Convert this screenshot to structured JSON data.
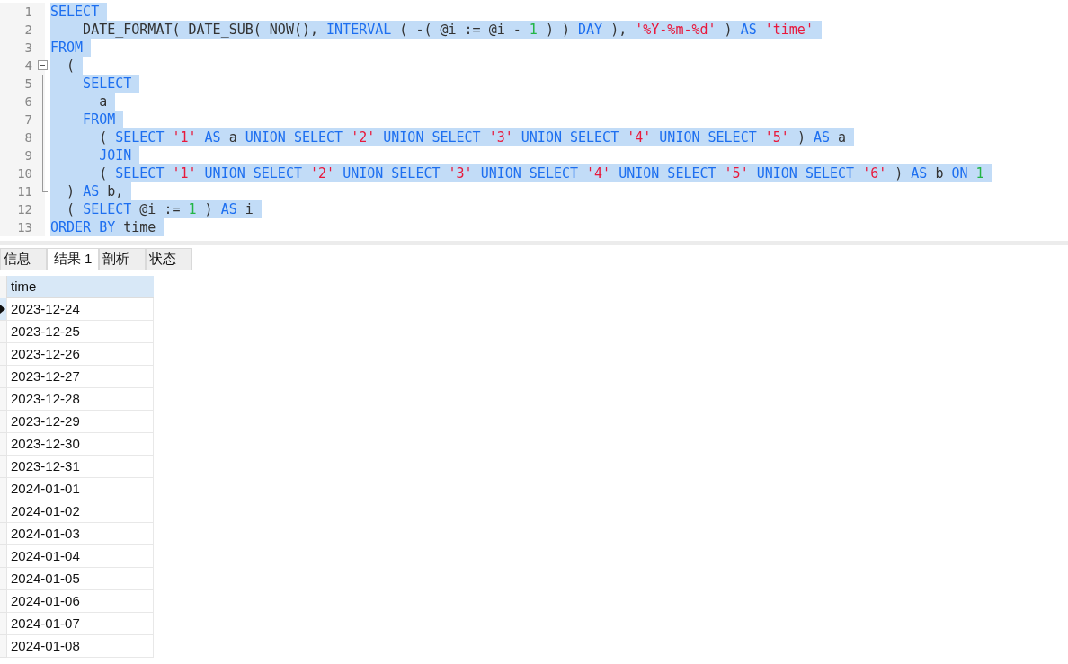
{
  "editor": {
    "lines": [
      {
        "number": "1",
        "selected": true,
        "kind": "plain",
        "tokens": [
          {
            "kind": "kw",
            "t": "SELECT "
          }
        ]
      },
      {
        "number": "2",
        "selected": true,
        "kind": "plain",
        "tokens": [
          {
            "kind": "p",
            "t": "    DATE_FORMAT( DATE_SUB( NOW(), "
          },
          {
            "kind": "kw",
            "t": "INTERVAL "
          },
          {
            "kind": "p",
            "t": "( -( @i := @i - "
          },
          {
            "kind": "num",
            "t": "1 "
          },
          {
            "kind": "p",
            "t": ") ) "
          },
          {
            "kind": "kw",
            "t": "DAY "
          },
          {
            "kind": "p",
            "t": "), "
          },
          {
            "kind": "str",
            "t": "'%Y-%m-%d' "
          },
          {
            "kind": "p",
            "t": ") "
          },
          {
            "kind": "kw",
            "t": "AS "
          },
          {
            "kind": "str",
            "t": "'time' "
          }
        ]
      },
      {
        "number": "3",
        "selected": true,
        "kind": "plain",
        "tokens": [
          {
            "kind": "kw",
            "t": "FROM "
          }
        ]
      },
      {
        "number": "4",
        "selected": true,
        "kind": "start",
        "tokens": [
          {
            "kind": "p",
            "t": "  ( "
          }
        ]
      },
      {
        "number": "5",
        "selected": true,
        "kind": "inner",
        "tokens": [
          {
            "kind": "kw",
            "t": "    SELECT "
          }
        ]
      },
      {
        "number": "6",
        "selected": true,
        "kind": "inner",
        "tokens": [
          {
            "kind": "p",
            "t": "      a "
          }
        ]
      },
      {
        "number": "7",
        "selected": true,
        "kind": "inner",
        "tokens": [
          {
            "kind": "kw",
            "t": "    FROM "
          }
        ]
      },
      {
        "number": "8",
        "selected": true,
        "kind": "inner",
        "tokens": [
          {
            "kind": "p",
            "t": "      ( "
          },
          {
            "kind": "kw",
            "t": "SELECT "
          },
          {
            "kind": "str",
            "t": "'1' "
          },
          {
            "kind": "kw",
            "t": "AS "
          },
          {
            "kind": "p",
            "t": "a "
          },
          {
            "kind": "kw",
            "t": "UNION SELECT "
          },
          {
            "kind": "str",
            "t": "'2' "
          },
          {
            "kind": "kw",
            "t": "UNION SELECT "
          },
          {
            "kind": "str",
            "t": "'3' "
          },
          {
            "kind": "kw",
            "t": "UNION SELECT "
          },
          {
            "kind": "str",
            "t": "'4' "
          },
          {
            "kind": "kw",
            "t": "UNION SELECT "
          },
          {
            "kind": "str",
            "t": "'5' "
          },
          {
            "kind": "p",
            "t": ") "
          },
          {
            "kind": "kw",
            "t": "AS "
          },
          {
            "kind": "p",
            "t": "a "
          }
        ]
      },
      {
        "number": "9",
        "selected": true,
        "kind": "inner",
        "tokens": [
          {
            "kind": "kw",
            "t": "      JOIN "
          }
        ]
      },
      {
        "number": "10",
        "selected": true,
        "kind": "inner",
        "tokens": [
          {
            "kind": "p",
            "t": "      ( "
          },
          {
            "kind": "kw",
            "t": "SELECT "
          },
          {
            "kind": "str",
            "t": "'1' "
          },
          {
            "kind": "kw",
            "t": "UNION SELECT "
          },
          {
            "kind": "str",
            "t": "'2' "
          },
          {
            "kind": "kw",
            "t": "UNION SELECT "
          },
          {
            "kind": "str",
            "t": "'3' "
          },
          {
            "kind": "kw",
            "t": "UNION SELECT "
          },
          {
            "kind": "str",
            "t": "'4' "
          },
          {
            "kind": "kw",
            "t": "UNION SELECT "
          },
          {
            "kind": "str",
            "t": "'5' "
          },
          {
            "kind": "kw",
            "t": "UNION SELECT "
          },
          {
            "kind": "str",
            "t": "'6' "
          },
          {
            "kind": "p",
            "t": ") "
          },
          {
            "kind": "kw",
            "t": "AS "
          },
          {
            "kind": "p",
            "t": "b "
          },
          {
            "kind": "kw",
            "t": "ON "
          },
          {
            "kind": "num",
            "t": "1 "
          }
        ]
      },
      {
        "number": "11",
        "selected": true,
        "kind": "end",
        "tokens": [
          {
            "kind": "p",
            "t": "  ) "
          },
          {
            "kind": "kw",
            "t": "AS "
          },
          {
            "kind": "p",
            "t": "b, "
          }
        ]
      },
      {
        "number": "12",
        "selected": true,
        "kind": "plain",
        "tokens": [
          {
            "kind": "p",
            "t": "  ( "
          },
          {
            "kind": "kw",
            "t": "SELECT "
          },
          {
            "kind": "p",
            "t": "@i := "
          },
          {
            "kind": "num",
            "t": "1 "
          },
          {
            "kind": "p",
            "t": ") "
          },
          {
            "kind": "kw",
            "t": "AS "
          },
          {
            "kind": "p",
            "t": "i "
          }
        ]
      },
      {
        "number": "13",
        "selected": true,
        "kind": "plain",
        "tokens": [
          {
            "kind": "kw",
            "t": "ORDER BY "
          },
          {
            "kind": "p",
            "t": "time "
          }
        ]
      }
    ]
  },
  "tabs": [
    {
      "label": "信息",
      "selected": false
    },
    {
      "label": "结果 1",
      "selected": true
    },
    {
      "label": "剖析",
      "selected": false
    },
    {
      "label": "状态",
      "selected": false
    }
  ],
  "table": {
    "columns": [
      "time"
    ],
    "rows": [
      {
        "cells": [
          "2023-12-24"
        ],
        "selected": true
      },
      {
        "cells": [
          "2023-12-25"
        ],
        "selected": false
      },
      {
        "cells": [
          "2023-12-26"
        ],
        "selected": false
      },
      {
        "cells": [
          "2023-12-27"
        ],
        "selected": false
      },
      {
        "cells": [
          "2023-12-28"
        ],
        "selected": false
      },
      {
        "cells": [
          "2023-12-29"
        ],
        "selected": false
      },
      {
        "cells": [
          "2023-12-30"
        ],
        "selected": false
      },
      {
        "cells": [
          "2023-12-31"
        ],
        "selected": false
      },
      {
        "cells": [
          "2024-01-01"
        ],
        "selected": false
      },
      {
        "cells": [
          "2024-01-02"
        ],
        "selected": false
      },
      {
        "cells": [
          "2024-01-03"
        ],
        "selected": false
      },
      {
        "cells": [
          "2024-01-04"
        ],
        "selected": false
      },
      {
        "cells": [
          "2024-01-05"
        ],
        "selected": false
      },
      {
        "cells": [
          "2024-01-06"
        ],
        "selected": false
      },
      {
        "cells": [
          "2024-01-07"
        ],
        "selected": false
      },
      {
        "cells": [
          "2024-01-08"
        ],
        "selected": false
      }
    ]
  }
}
